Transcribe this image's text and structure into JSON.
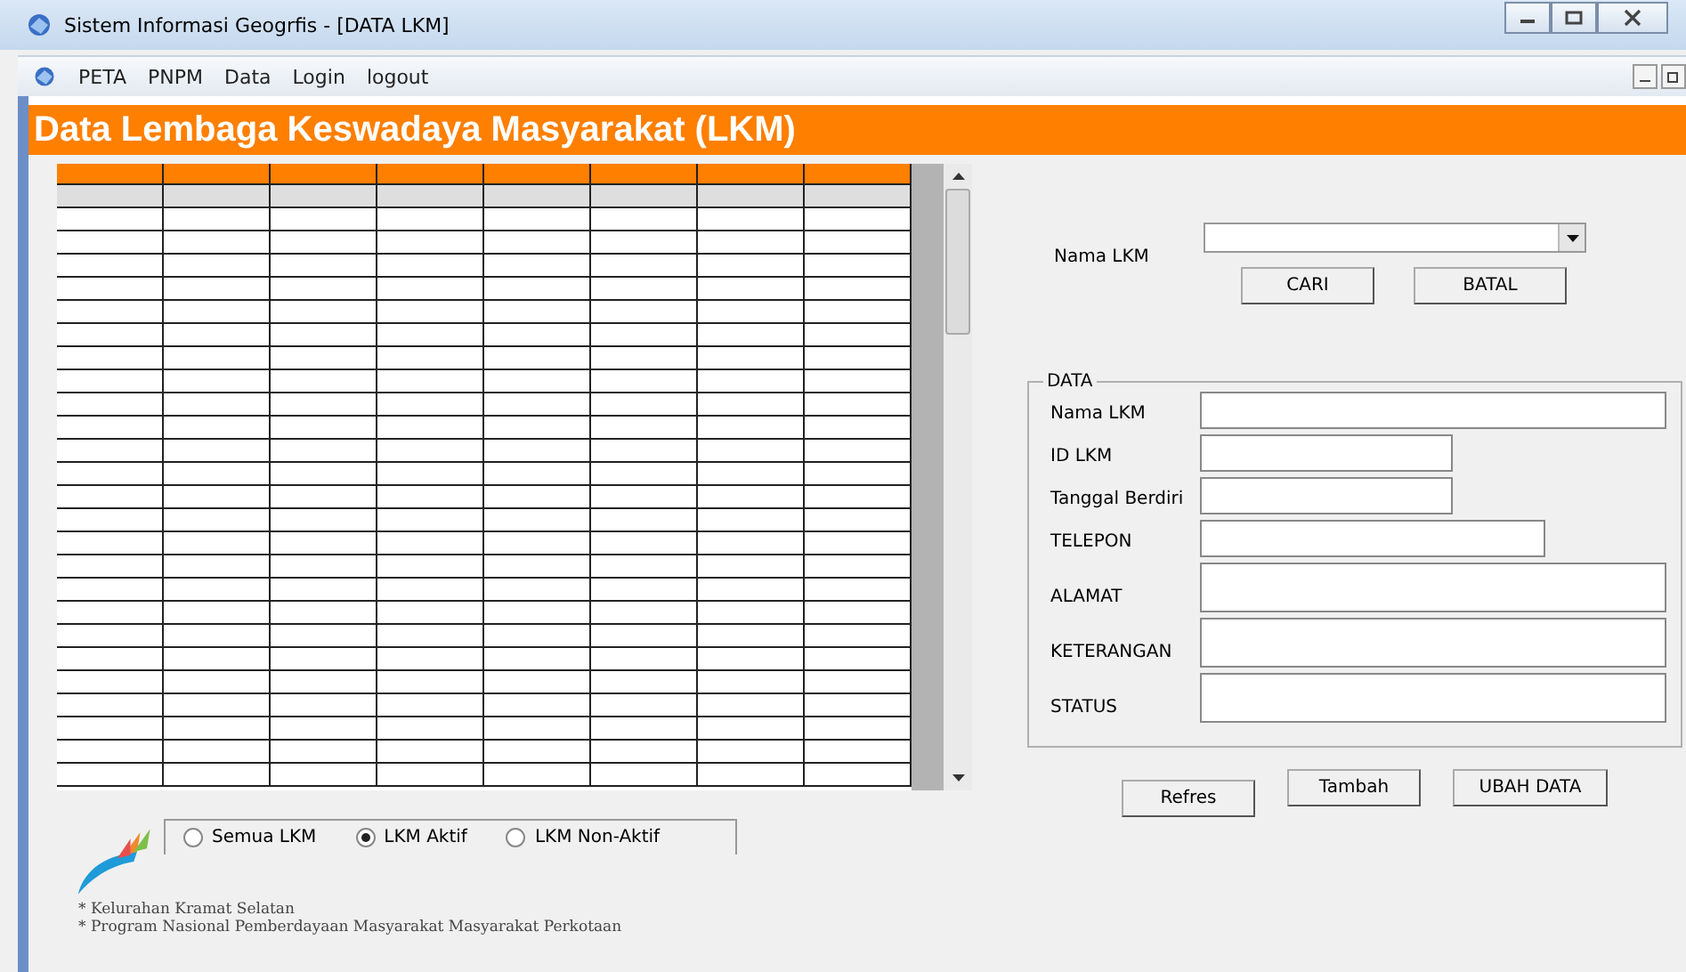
{
  "window": {
    "title": "Sistem Informasi Geogrfis - [DATA LKM]"
  },
  "menu": [
    {
      "label": "PETA"
    },
    {
      "label": "PNPM"
    },
    {
      "label": "Data"
    },
    {
      "label": "Login"
    },
    {
      "label": "logout"
    }
  ],
  "banner": {
    "title": "Data Lembaga Keswadaya Masyarakat  (LKM)"
  },
  "search": {
    "label": "Nama LKM",
    "buttons": [
      "CARI",
      "BATAL"
    ]
  },
  "data_group": {
    "title": "DATA",
    "fields": [
      {
        "label": "Nama LKM",
        "kind": "wide"
      },
      {
        "label": "ID LKM",
        "kind": "short"
      },
      {
        "label": "Tanggal Berdiri",
        "kind": "short"
      },
      {
        "label": "TELEPON",
        "kind": "medium"
      },
      {
        "label": "ALAMAT",
        "kind": "tall"
      },
      {
        "label": "KETERANGAN",
        "kind": "tall"
      },
      {
        "label": "STATUS",
        "kind": "tall"
      }
    ]
  },
  "filter": [
    {
      "label": "Semua LKM",
      "selected": false
    },
    {
      "label": "LKM Aktif",
      "selected": true
    },
    {
      "label": "LKM Non-Aktif",
      "selected": false
    }
  ],
  "notes": [
    "* Kelurahan Kramat Selatan",
    "*  Program Nasional Pemberdayaan Masyarakat   Masyarakat Perkotaan"
  ],
  "actions": [
    {
      "label": "Refres",
      "kind": "low"
    },
    {
      "label": "Tambah",
      "kind": "high"
    },
    {
      "label": "UBAH DATA",
      "kind": "high"
    }
  ]
}
